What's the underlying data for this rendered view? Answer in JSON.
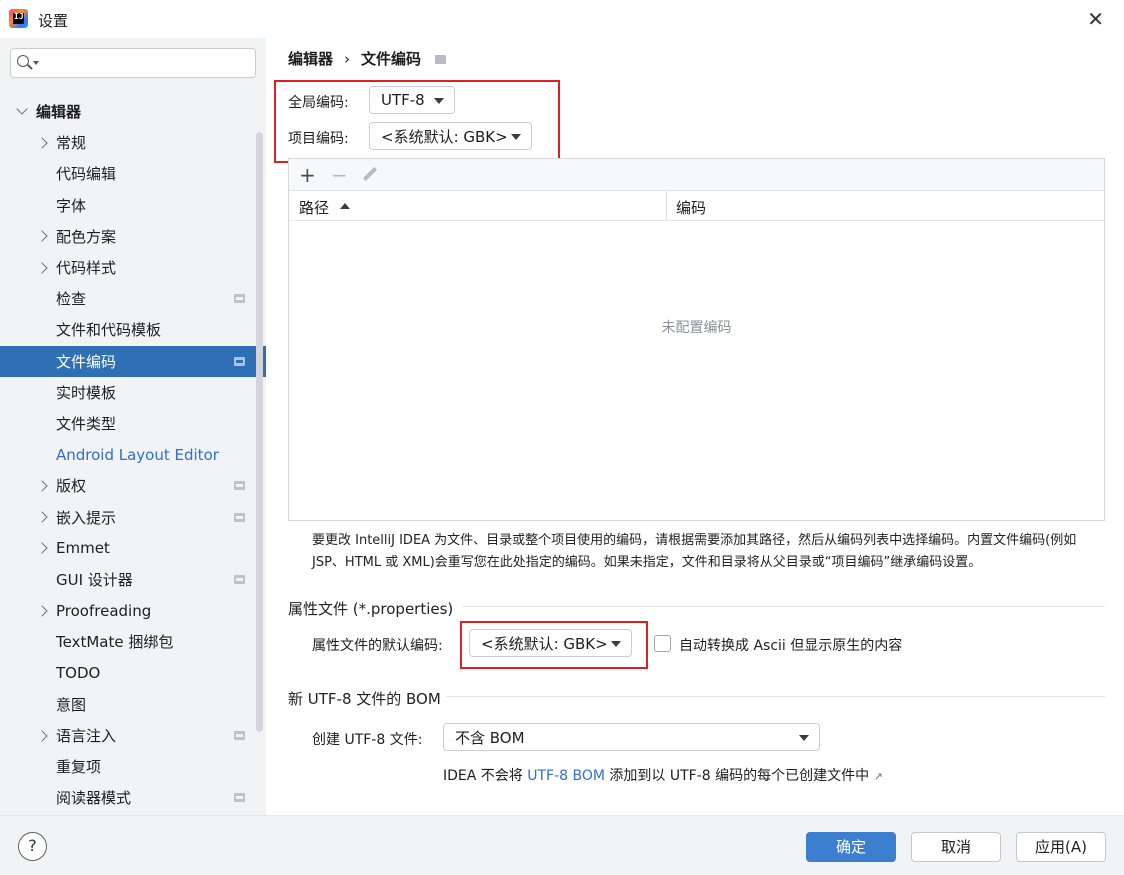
{
  "window": {
    "title": "设置"
  },
  "sidebar": {
    "search_placeholder": "",
    "items": [
      {
        "label": "编辑器",
        "level": 0,
        "expanded": true
      },
      {
        "label": "常规",
        "level": 1,
        "expandable": true
      },
      {
        "label": "代码编辑",
        "level": 1
      },
      {
        "label": "字体",
        "level": 1
      },
      {
        "label": "配色方案",
        "level": 1,
        "expandable": true
      },
      {
        "label": "代码样式",
        "level": 1,
        "expandable": true
      },
      {
        "label": "检查",
        "level": 1,
        "has_doc_icon": true
      },
      {
        "label": "文件和代码模板",
        "level": 1
      },
      {
        "label": "文件编码",
        "level": 1,
        "selected": true,
        "has_doc_icon": true
      },
      {
        "label": "实时模板",
        "level": 1
      },
      {
        "label": "文件类型",
        "level": 1
      },
      {
        "label": "Android Layout Editor",
        "level": 1,
        "link": true
      },
      {
        "label": "版权",
        "level": 1,
        "expandable": true,
        "has_doc_icon": true
      },
      {
        "label": "嵌入提示",
        "level": 1,
        "expandable": true,
        "has_doc_icon": true
      },
      {
        "label": "Emmet",
        "level": 1,
        "expandable": true
      },
      {
        "label": "GUI 设计器",
        "level": 1,
        "has_doc_icon": true
      },
      {
        "label": "Proofreading",
        "level": 1,
        "expandable": true
      },
      {
        "label": "TextMate 捆绑包",
        "level": 1
      },
      {
        "label": "TODO",
        "level": 1
      },
      {
        "label": "意图",
        "level": 1
      },
      {
        "label": "语言注入",
        "level": 1,
        "expandable": true,
        "has_doc_icon": true
      },
      {
        "label": "重复项",
        "level": 1
      },
      {
        "label": "阅读器模式",
        "level": 1,
        "has_doc_icon": true
      }
    ]
  },
  "breadcrumb": {
    "parent": "编辑器",
    "separator": "›",
    "current": "文件编码"
  },
  "encoding": {
    "global_label": "全局编码:",
    "global_value": "UTF-8",
    "project_label": "项目编码:",
    "project_value": "<系统默认: GBK>"
  },
  "table": {
    "toolbar": {
      "add": "+",
      "remove": "−"
    },
    "columns": [
      "路径",
      "编码"
    ],
    "empty_text": "未配置编码"
  },
  "help_text": "要更改 IntelliJ IDEA 为文件、目录或整个项目使用的编码，请根据需要添加其路径，然后从编码列表中选择编码。内置文件编码(例如 JSP、HTML 或 XML)会重写您在此处指定的编码。如果未指定，文件和目录将从父目录或“项目编码”继承编码设置。",
  "properties": {
    "section_title": "属性文件 (*.properties)",
    "default_label": "属性文件的默认编码:",
    "default_value": "<系统默认: GBK>",
    "ascii_checkbox_label": "自动转换成 Ascii 但显示原生的内容",
    "ascii_checked": false
  },
  "bom": {
    "section_title": "新 UTF-8 文件的 BOM",
    "create_label": "创建 UTF-8 文件:",
    "create_value": "不含 BOM",
    "note_prefix": "IDEA 不会将",
    "note_link": "UTF-8 BOM",
    "note_suffix": "添加到以 UTF-8 编码的每个已创建文件中",
    "note_arrow": "↗"
  },
  "footer": {
    "help": "?",
    "ok": "确定",
    "cancel": "取消",
    "apply": "应用(A)"
  },
  "colors": {
    "accent": "#2f6fb6",
    "highlight_box": "#e02020",
    "link": "#2e6fcf",
    "primary_button": "#3d7fcf"
  }
}
